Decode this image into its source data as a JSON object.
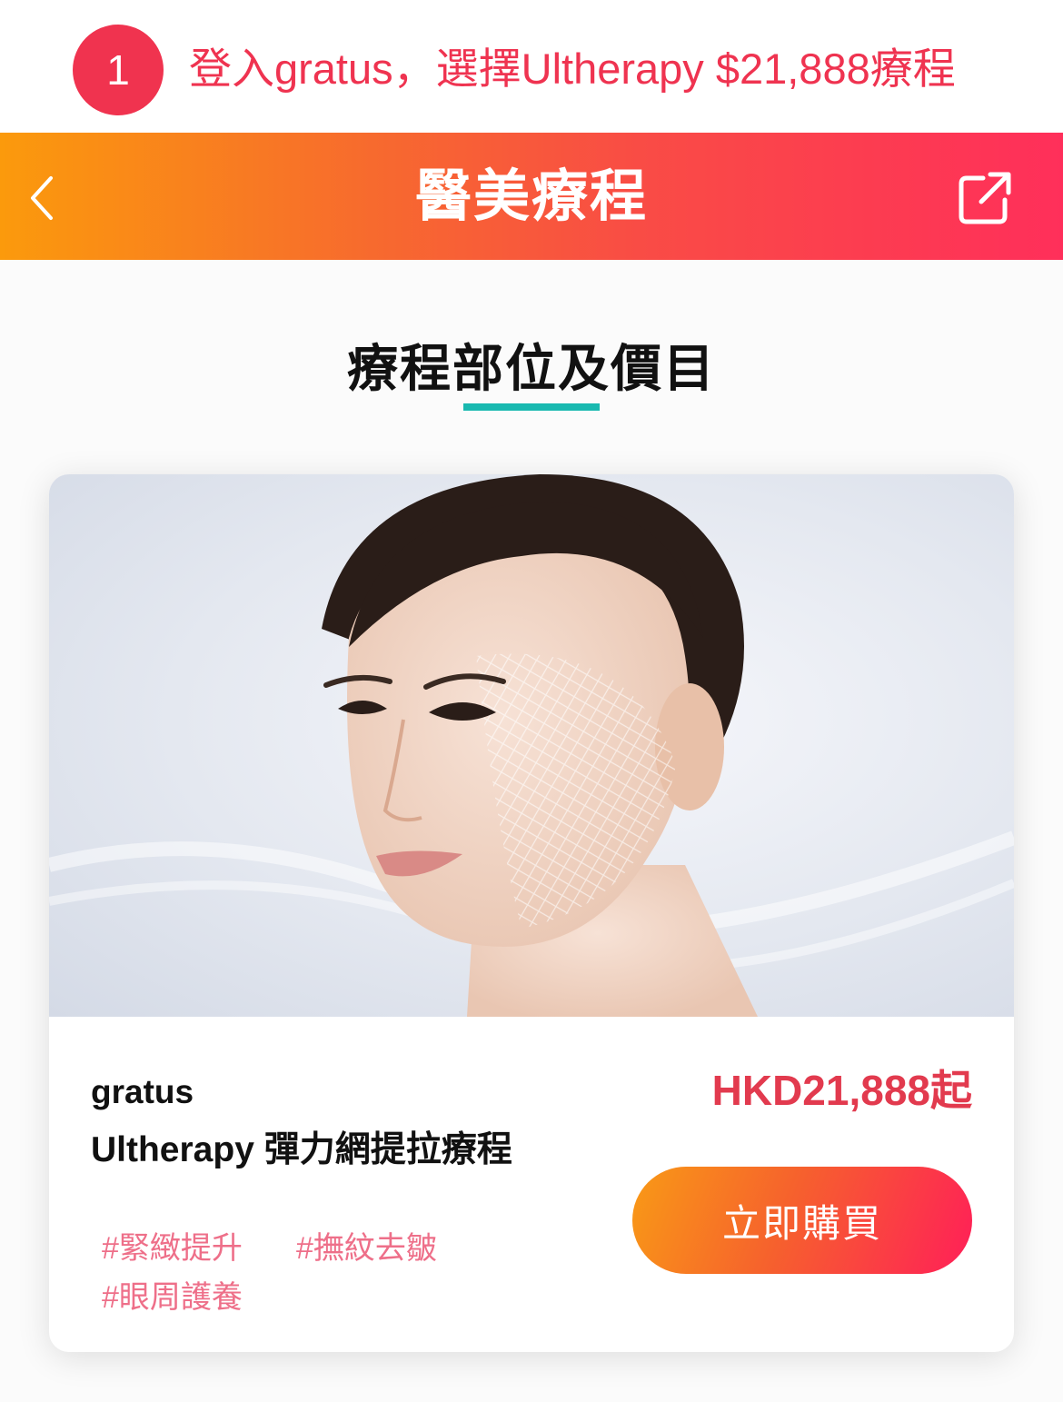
{
  "step": {
    "number": "1",
    "text": "登入gratus，選擇Ultherapy $21,888療程"
  },
  "header": {
    "title": "醫美療程",
    "back_icon": "chevron-left-icon",
    "share_icon": "external-link-icon"
  },
  "section": {
    "title": "療程部位及價目",
    "accent_color": "#19b9b0"
  },
  "product": {
    "vendor": "gratus",
    "name": "Ultherapy 彈力網提拉療程",
    "price": "HKD21,888起",
    "buy_label": "立即購買",
    "tags": [
      "#緊緻提升",
      "#撫紋去皺",
      "#眼周護養"
    ],
    "price_color": "#e23a4e",
    "tag_color": "#ee6f89"
  },
  "colors": {
    "brand_gradient_start": "#fb9a0c",
    "brand_gradient_end": "#ff2f5a",
    "step_badge": "#f0334f"
  }
}
